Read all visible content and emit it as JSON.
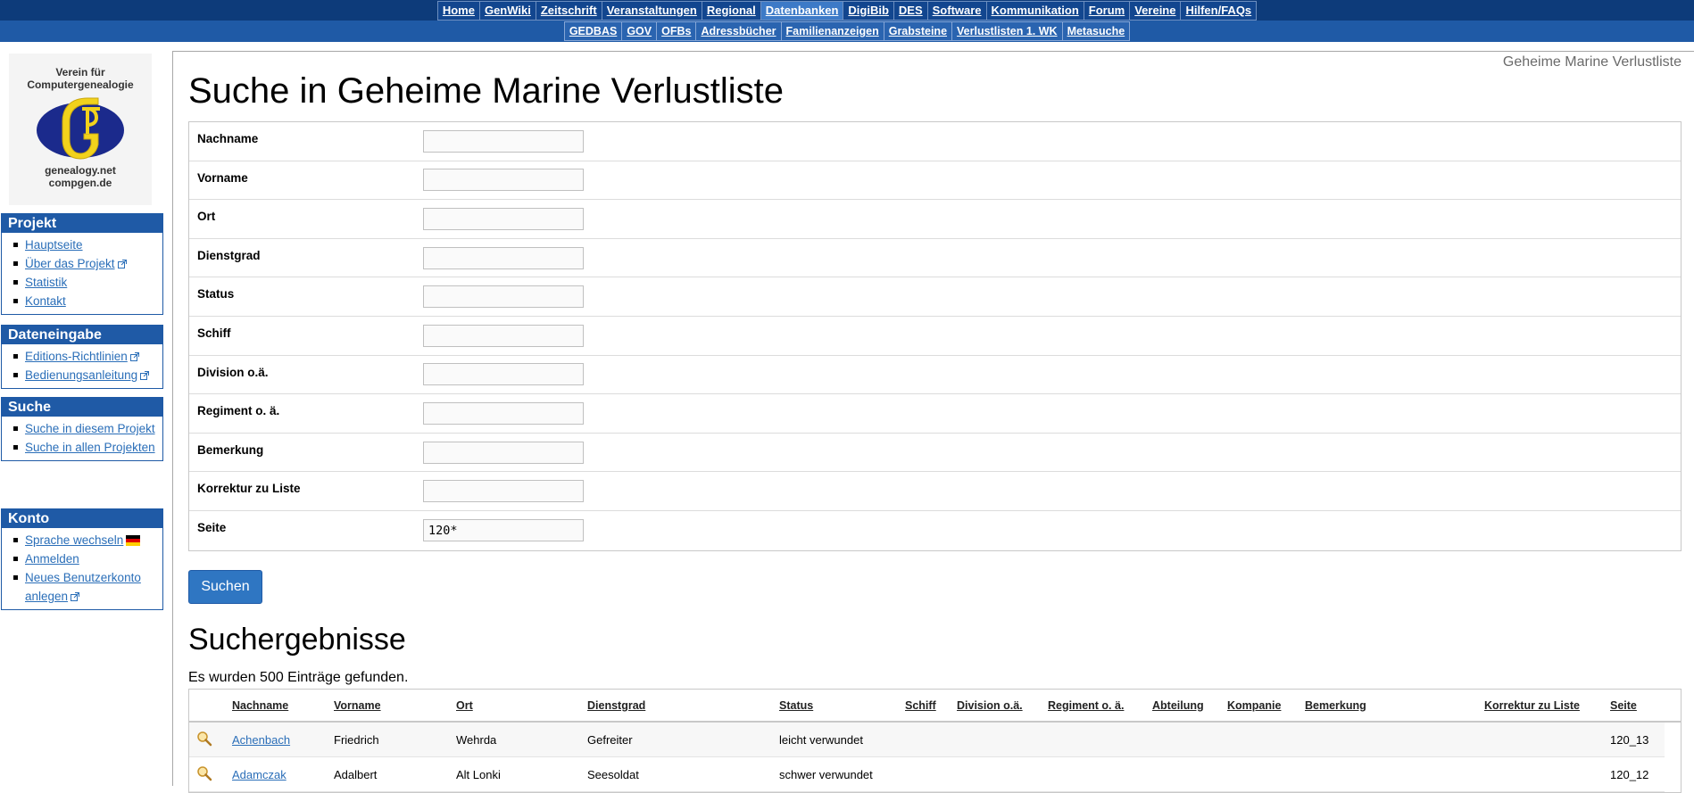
{
  "topnav": {
    "main": [
      {
        "label": "Home",
        "active": false
      },
      {
        "label": "GenWiki",
        "active": false
      },
      {
        "label": "Zeitschrift",
        "active": false
      },
      {
        "label": "Veranstaltungen",
        "active": false
      },
      {
        "label": "Regional",
        "active": false
      },
      {
        "label": "Datenbanken",
        "active": true
      },
      {
        "label": "DigiBib",
        "active": false
      },
      {
        "label": "DES",
        "active": false
      },
      {
        "label": "Software",
        "active": false
      },
      {
        "label": "Kommunikation",
        "active": false
      },
      {
        "label": "Forum",
        "active": false
      },
      {
        "label": "Vereine",
        "active": false
      },
      {
        "label": "Hilfen/FAQs",
        "active": false
      }
    ],
    "sub": [
      {
        "label": "GEDBAS"
      },
      {
        "label": "GOV"
      },
      {
        "label": "OFBs"
      },
      {
        "label": "Adressbücher"
      },
      {
        "label": "Familienanzeigen"
      },
      {
        "label": "Grabsteine"
      },
      {
        "label": "Verlustlisten 1. WK"
      },
      {
        "label": "Metasuche"
      }
    ]
  },
  "logo": {
    "top_line1": "Verein für",
    "top_line2": "Computergenealogie",
    "bottom_line1": "genealogy.net",
    "bottom_line2": "compgen.de"
  },
  "sidebar": {
    "projekt": {
      "title": "Projekt",
      "items": [
        "Hauptseite",
        "Über das Projekt",
        "Statistik",
        "Kontakt"
      ]
    },
    "dateneingabe": {
      "title": "Dateneingabe",
      "items": [
        "Editions-Richtlinien",
        "Bedienungsanleitung"
      ]
    },
    "suche": {
      "title": "Suche",
      "items": [
        "Suche in diesem Projekt",
        "Suche in allen Projekten"
      ]
    },
    "konto": {
      "title": "Konto",
      "items": [
        "Sprache wechseln",
        "Anmelden",
        "Neues Benutzerkonto anlegen"
      ]
    }
  },
  "breadcrumb": "Geheime Marine Verlustliste",
  "page_title": "Suche in Geheime Marine Verlustliste",
  "form": {
    "fields": [
      {
        "label": "Nachname",
        "value": ""
      },
      {
        "label": "Vorname",
        "value": ""
      },
      {
        "label": "Ort",
        "value": ""
      },
      {
        "label": "Dienstgrad",
        "value": ""
      },
      {
        "label": "Status",
        "value": ""
      },
      {
        "label": "Schiff",
        "value": ""
      },
      {
        "label": "Division o.ä.",
        "value": ""
      },
      {
        "label": "Regiment o. ä.",
        "value": ""
      },
      {
        "label": "Bemerkung",
        "value": ""
      },
      {
        "label": "Korrektur zu Liste",
        "value": ""
      },
      {
        "label": "Seite",
        "value": "120*"
      }
    ],
    "submit_label": "Suchen"
  },
  "results": {
    "title": "Suchergebnisse",
    "count_text": "Es wurden 500 Einträge gefunden.",
    "columns": [
      "Nachname",
      "Vorname",
      "Ort",
      "Dienstgrad",
      "Status",
      "Schiff",
      "Division o.ä.",
      "Regiment o. ä.",
      "Abteilung",
      "Kompanie",
      "Bemerkung",
      "Korrektur zu Liste",
      "Seite"
    ],
    "rows": [
      [
        "Achenbach",
        "Friedrich",
        "Wehrda",
        "Gefreiter",
        "leicht verwundet",
        "",
        "",
        "",
        "",
        "",
        "",
        "",
        "120_13"
      ],
      [
        "Adamczak",
        "Adalbert",
        "Alt Lonki",
        "Seesoldat",
        "schwer verwundet",
        "",
        "",
        "",
        "",
        "",
        "",
        "",
        "120_12"
      ]
    ]
  },
  "colors": {
    "topbar_main": "#0d3b7a",
    "topbar_sub": "#1f5aa6",
    "portlet_head": "#1f5aa6",
    "link": "#2a6eb8",
    "button": "#2f76c2"
  }
}
